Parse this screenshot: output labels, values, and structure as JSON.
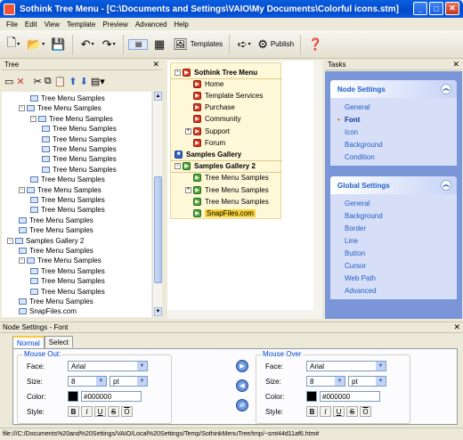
{
  "window": {
    "title": "Sothink Tree Menu - [C:\\Documents and Settings\\VAIO\\My Documents\\Colorful icons.stm]"
  },
  "menubar": [
    "File",
    "Edit",
    "View",
    "Template",
    "Preview",
    "Advanced",
    "Help"
  ],
  "toolbar": {
    "templates_label": "Templates",
    "publish_label": "Publish"
  },
  "tree_panel": {
    "title": "Tree",
    "rows": [
      {
        "label": "Tree Menu Samples",
        "indent": 2,
        "exp": ""
      },
      {
        "label": "Tree Menu Samples",
        "indent": 1,
        "exp": "-"
      },
      {
        "label": "Tree Menu Samples",
        "indent": 2,
        "exp": "-"
      },
      {
        "label": "Tree Menu Samples",
        "indent": 3,
        "exp": ""
      },
      {
        "label": "Tree Menu Samples",
        "indent": 3,
        "exp": ""
      },
      {
        "label": "Tree Menu Samples",
        "indent": 3,
        "exp": ""
      },
      {
        "label": "Tree Menu Samples",
        "indent": 3,
        "exp": ""
      },
      {
        "label": "Tree Menu Samples",
        "indent": 3,
        "exp": ""
      },
      {
        "label": "Tree Menu Samples",
        "indent": 2,
        "exp": ""
      },
      {
        "label": "Tree Menu Samples",
        "indent": 1,
        "exp": "-"
      },
      {
        "label": "Tree Menu Samples",
        "indent": 2,
        "exp": ""
      },
      {
        "label": "Tree Menu Samples",
        "indent": 2,
        "exp": ""
      },
      {
        "label": "Tree Menu Samples",
        "indent": 1,
        "exp": ""
      },
      {
        "label": "Tree Menu Samples",
        "indent": 1,
        "exp": ""
      },
      {
        "label": "Samples Gallery 2",
        "indent": 0,
        "exp": "-"
      },
      {
        "label": "Tree Menu Samples",
        "indent": 1,
        "exp": ""
      },
      {
        "label": "Tree Menu Samples",
        "indent": 1,
        "exp": "-"
      },
      {
        "label": "Tree Menu Samples",
        "indent": 2,
        "exp": ""
      },
      {
        "label": "Tree Menu Samples",
        "indent": 2,
        "exp": ""
      },
      {
        "label": "Tree Menu Samples",
        "indent": 2,
        "exp": ""
      },
      {
        "label": "Tree Menu Samples",
        "indent": 1,
        "exp": ""
      },
      {
        "label": "SnapFiles.com",
        "indent": 1,
        "exp": ""
      }
    ]
  },
  "preview_menu": {
    "items": [
      {
        "label": "Sothink Tree Menu",
        "icon": "red",
        "head": true,
        "indent": 0,
        "exp": "-"
      },
      {
        "label": "Home",
        "icon": "red",
        "head": false,
        "indent": 1,
        "exp": ""
      },
      {
        "label": "Template Services",
        "icon": "red",
        "head": false,
        "indent": 1,
        "exp": ""
      },
      {
        "label": "Purchase",
        "icon": "red",
        "head": false,
        "indent": 1,
        "exp": ""
      },
      {
        "label": "Community",
        "icon": "red",
        "head": false,
        "indent": 1,
        "exp": ""
      },
      {
        "label": "Support",
        "icon": "red",
        "head": false,
        "indent": 1,
        "exp": "+"
      },
      {
        "label": "Forum",
        "icon": "red",
        "head": false,
        "indent": 1,
        "exp": ""
      },
      {
        "label": "Samples Gallery",
        "icon": "blue",
        "head": true,
        "indent": 0,
        "exp": ""
      },
      {
        "label": "Samples Gallery 2",
        "icon": "green",
        "head": true,
        "indent": 0,
        "exp": "-"
      },
      {
        "label": "Tree Menu Samples",
        "icon": "green",
        "head": false,
        "indent": 1,
        "exp": ""
      },
      {
        "label": "Tree Menu Samples",
        "icon": "green",
        "head": false,
        "indent": 1,
        "exp": "+"
      },
      {
        "label": "Tree Menu Samples",
        "icon": "green",
        "head": false,
        "indent": 1,
        "exp": ""
      },
      {
        "label": "SnapFiles.com",
        "icon": "green",
        "head": false,
        "indent": 1,
        "exp": "",
        "highlight": true
      }
    ]
  },
  "tasks_panel": {
    "title": "Tasks",
    "node_settings": {
      "title": "Node Settings",
      "items": [
        "General",
        "Font",
        "Icon",
        "Background",
        "Condition"
      ],
      "active": "Font"
    },
    "global_settings": {
      "title": "Global Settings",
      "items": [
        "General",
        "Background",
        "Border",
        "Line",
        "Button",
        "Cursor",
        "Web Path",
        "Advanced"
      ]
    }
  },
  "node_settings_panel": {
    "title": "Node Settings - Font",
    "tabs": [
      "Normal",
      "Select"
    ],
    "mouse_out": {
      "title": "Mouse Out:",
      "face": "Arial",
      "size": "8",
      "unit": "pt",
      "color": "#000000"
    },
    "mouse_over": {
      "title": "Mouse Over",
      "face": "Arial",
      "size": "8",
      "unit": "pt",
      "color": "#000000"
    },
    "labels": {
      "face": "Face:",
      "size": "Size:",
      "color": "Color:",
      "style": "Style:"
    },
    "style_buttons": [
      "B",
      "I",
      "U",
      "S",
      "O"
    ]
  },
  "statusbar": {
    "text": "file:///C:/Documents%20and%20Settings/VAIO/Local%20Settings/Temp/SothinkMenuTree/tmp/~smt44d11af6.htm#"
  },
  "colors": {
    "title_bar": "#0348c9",
    "tasks_bg": "#7a96d8",
    "task_link": "#215dc6",
    "preview_bg": "#fff8d8",
    "highlight": "#f5d23a"
  }
}
